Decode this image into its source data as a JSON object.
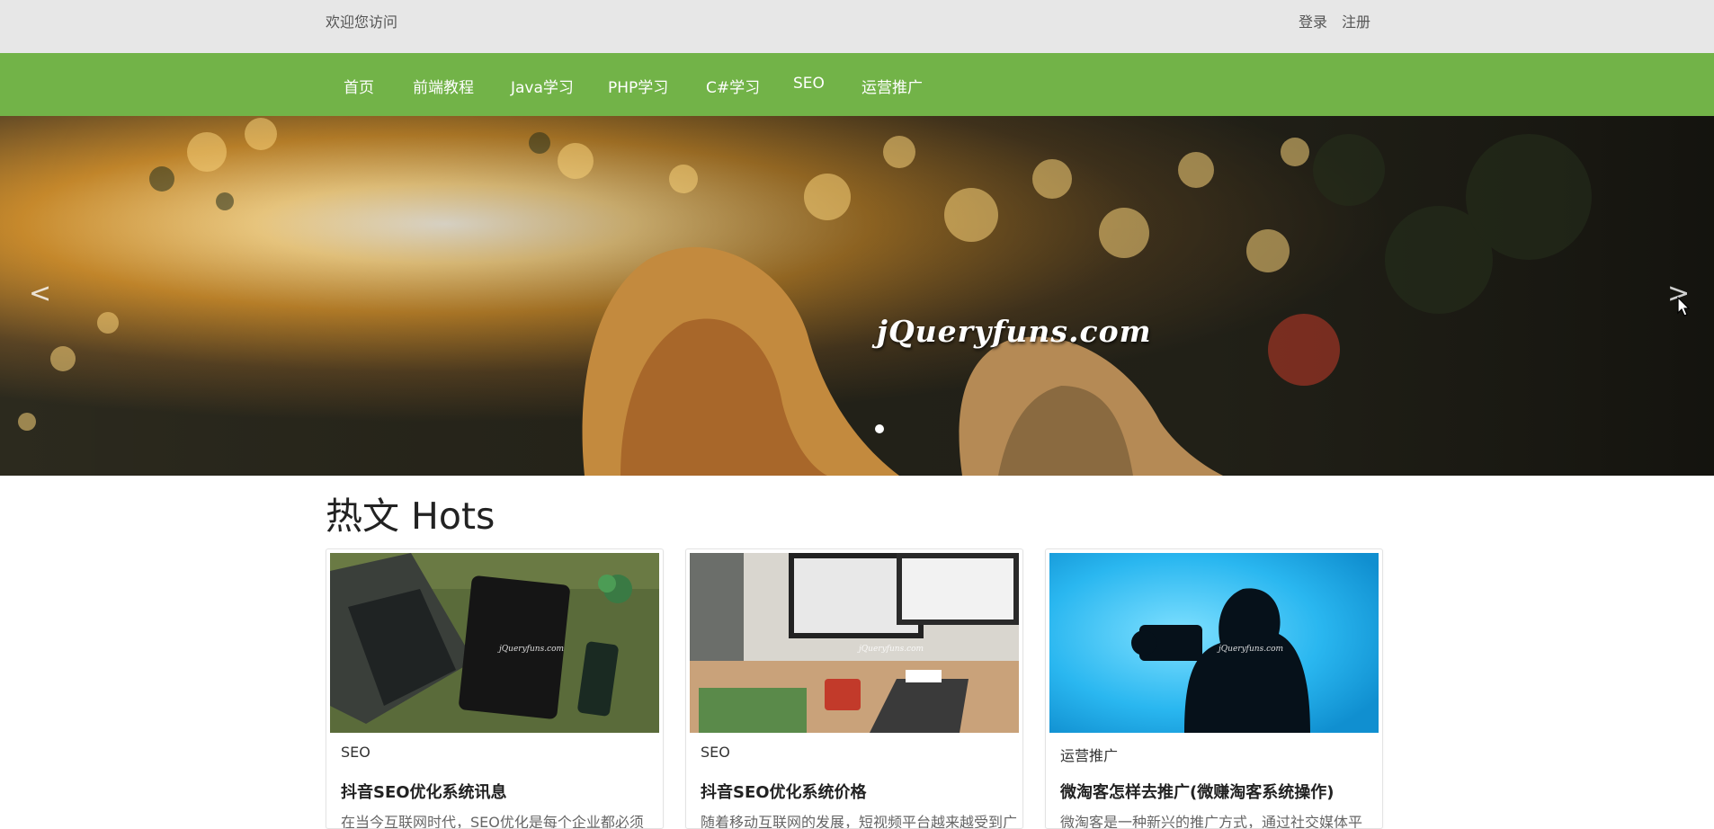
{
  "topbar": {
    "welcome": "欢迎您访问",
    "login": "登录",
    "register": "注册"
  },
  "nav": [
    "首页",
    "前端教程",
    "Java学习",
    "PHP学习",
    "C#学习",
    "SEO",
    "运营推广"
  ],
  "hero": {
    "brand": "jQueryfuns.com",
    "prev": "<",
    "next": ">"
  },
  "section": {
    "title": "热文 Hots"
  },
  "cards": [
    {
      "category": "SEO",
      "title": "抖音SEO优化系统讯息",
      "excerpt": "在当今互联网时代，SEO优化是每个企业都必须"
    },
    {
      "category": "SEO",
      "title": "抖音SEO优化系统价格",
      "excerpt": "随着移动互联网的发展，短视频平台越来越受到广"
    },
    {
      "category": "运营推广",
      "title": "微淘客怎样去推广(微赚淘客系统操作)",
      "excerpt": "微淘客是一种新兴的推广方式，通过社交媒体平"
    }
  ],
  "colors": {
    "nav": "#72b348",
    "topbar": "#e7e7e7"
  }
}
